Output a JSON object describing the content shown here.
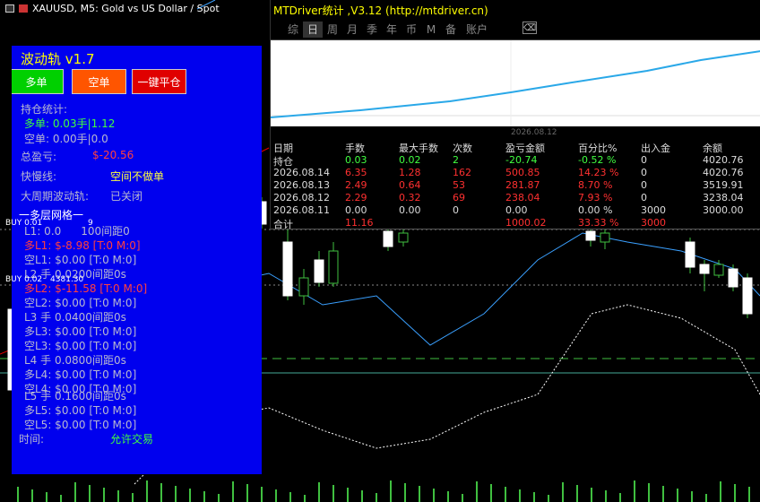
{
  "chart": {
    "title": "XAUUSD, M5:  Gold vs US Dollar / Spot",
    "buy_label_1": "BUY 0.01",
    "buy_label_1_suffix": "9",
    "buy_label_2": "BUY 0.02",
    "buy_label_2_price": "4381.30",
    "colors": {
      "up": "#ffffff",
      "down": "#000000",
      "ma_red": "#e00000",
      "ma_blue": "#3aa0ff",
      "dashed": "#ffffff",
      "level_green": "#40c040"
    }
  },
  "panel": {
    "title": "波动轨 v1.7",
    "buttons": {
      "buy": "多单",
      "sell": "空单",
      "close_all": "一键平仓"
    },
    "position_stats": "持仓统计:",
    "long_line": "多单: 0.03手|1.12",
    "short_line": "空单: 0.00手|0.0",
    "total_profit_label": "总盈亏:",
    "total_profit_value": "$-20.56",
    "fast_slow_label": "快慢线:",
    "fast_slow_value": "空间不做单",
    "big_cycle_label": "大周期波动轨:",
    "big_cycle_value": "已关闭",
    "grid_title": "一多层网格一",
    "l1": "L1: 0.0",
    "l1_rest": "100间距0",
    "l1_long": "多L1: $-8.98 [T:0 M:0]",
    "l1_short": "空L1: $0.00 [T:0 M:0]",
    "l2": "L2 手 0.0200间距0s",
    "l2_long": "多L2: $-11.58 [T:0 M:0]",
    "l2_short": "空L2: $0.00 [T:0 M:0]",
    "l3": "L3 手 0.0400间距0s",
    "l3_long": "多L3: $0.00 [T:0 M:0]",
    "l3_short": "空L3: $0.00 [T:0 M:0]",
    "l4": "L4 手 0.0800间距0s",
    "l4_long": "多L4: $0.00 [T:0 M:0]",
    "l4_short": "空L4: $0.00 [T:0 M:0]",
    "l5": "L5 手 0.1600间距0s",
    "l5_long": "多L5: $0.00 [T:0 M:0]",
    "l5_short": "空L5: $0.00 [T:0 M:0]",
    "time_label": "时间:",
    "time_value": "允许交易"
  },
  "stats": {
    "title": "MTDriver统计 ,V3.12 (http://mtdriver.cn)",
    "tabs": [
      "综",
      "日",
      "周",
      "月",
      "季",
      "年",
      "币",
      "M",
      "备",
      "账户"
    ],
    "active_tab": "日",
    "graph_date": "2026.08.12",
    "headers": [
      "日期",
      "手数",
      "最大手数",
      "次数",
      "盈亏金额",
      "百分比%",
      "出入金",
      "余额"
    ],
    "rows": [
      {
        "date": "持仓",
        "lots": "0.03",
        "max": "0.02",
        "count": "2",
        "pnl": "-20.74",
        "pct": "-0.52 %",
        "io": "0",
        "bal": "4020.76",
        "tone": "green"
      },
      {
        "date": "2026.08.14",
        "lots": "6.35",
        "max": "1.28",
        "count": "162",
        "pnl": "500.85",
        "pct": "14.23 %",
        "io": "0",
        "bal": "4020.76",
        "tone": "red"
      },
      {
        "date": "2026.08.13",
        "lots": "2.49",
        "max": "0.64",
        "count": "53",
        "pnl": "281.87",
        "pct": "8.70 %",
        "io": "0",
        "bal": "3519.91",
        "tone": "red"
      },
      {
        "date": "2026.08.12",
        "lots": "2.29",
        "max": "0.32",
        "count": "69",
        "pnl": "238.04",
        "pct": "7.93 %",
        "io": "0",
        "bal": "3238.04",
        "tone": "red"
      },
      {
        "date": "2026.08.11",
        "lots": "0.00",
        "max": "0.00",
        "count": "0",
        "pnl": "0.00",
        "pct": "0.00 %",
        "io": "3000",
        "bal": "3000.00",
        "tone": "white"
      }
    ],
    "total": {
      "date": "合计",
      "lots": "11.16",
      "pnl": "1000.02",
      "pct": "33.33 %",
      "io": "3000"
    }
  }
}
